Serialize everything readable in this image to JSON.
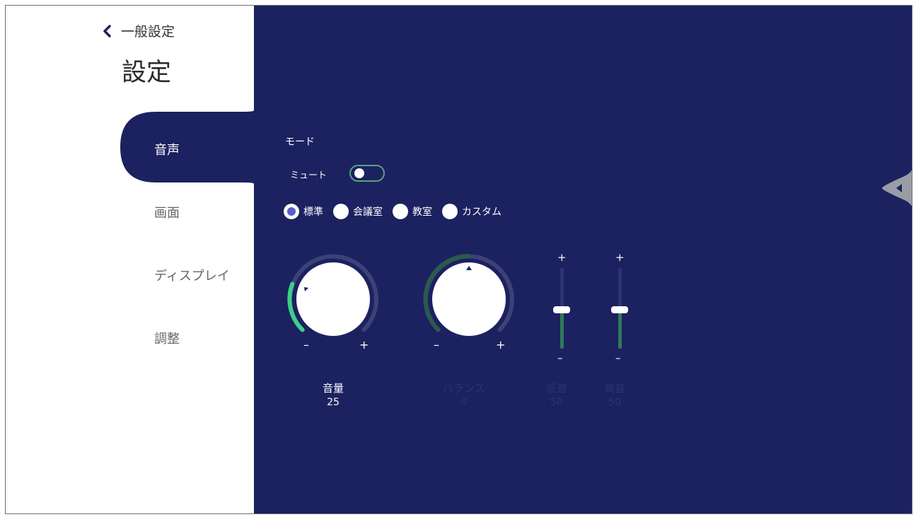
{
  "header": {
    "back_label": "一般設定",
    "title": "設定"
  },
  "sidebar": {
    "items": [
      {
        "label": "音声",
        "active": true
      },
      {
        "label": "画面",
        "active": false
      },
      {
        "label": "ディスプレイ",
        "active": false
      },
      {
        "label": "調整",
        "active": false
      }
    ]
  },
  "audio": {
    "mode_label": "モード",
    "mute_label": "ミュート",
    "mute_on": false,
    "modes": [
      {
        "label": "標準",
        "selected": true
      },
      {
        "label": "会議室",
        "selected": false
      },
      {
        "label": "教室",
        "selected": false
      },
      {
        "label": "カスタム",
        "selected": false
      }
    ],
    "volume": {
      "label": "音量",
      "value": "25",
      "level": 25
    },
    "balance": {
      "label": "バランス",
      "value": "0",
      "level": 0
    },
    "bass": {
      "label": "低音",
      "value": "50",
      "level": 50
    },
    "treble": {
      "label": "高音",
      "value": "50",
      "level": 50
    },
    "plus_symbol": "+",
    "minus_symbol": "–"
  },
  "colors": {
    "panel_bg": "#1c2160",
    "accent_green": "#3ecf86",
    "track": "#3c4276",
    "active_text": "#ffffff"
  },
  "icons": {
    "back": "chevron-left-icon",
    "drawer": "caret-left-icon"
  }
}
